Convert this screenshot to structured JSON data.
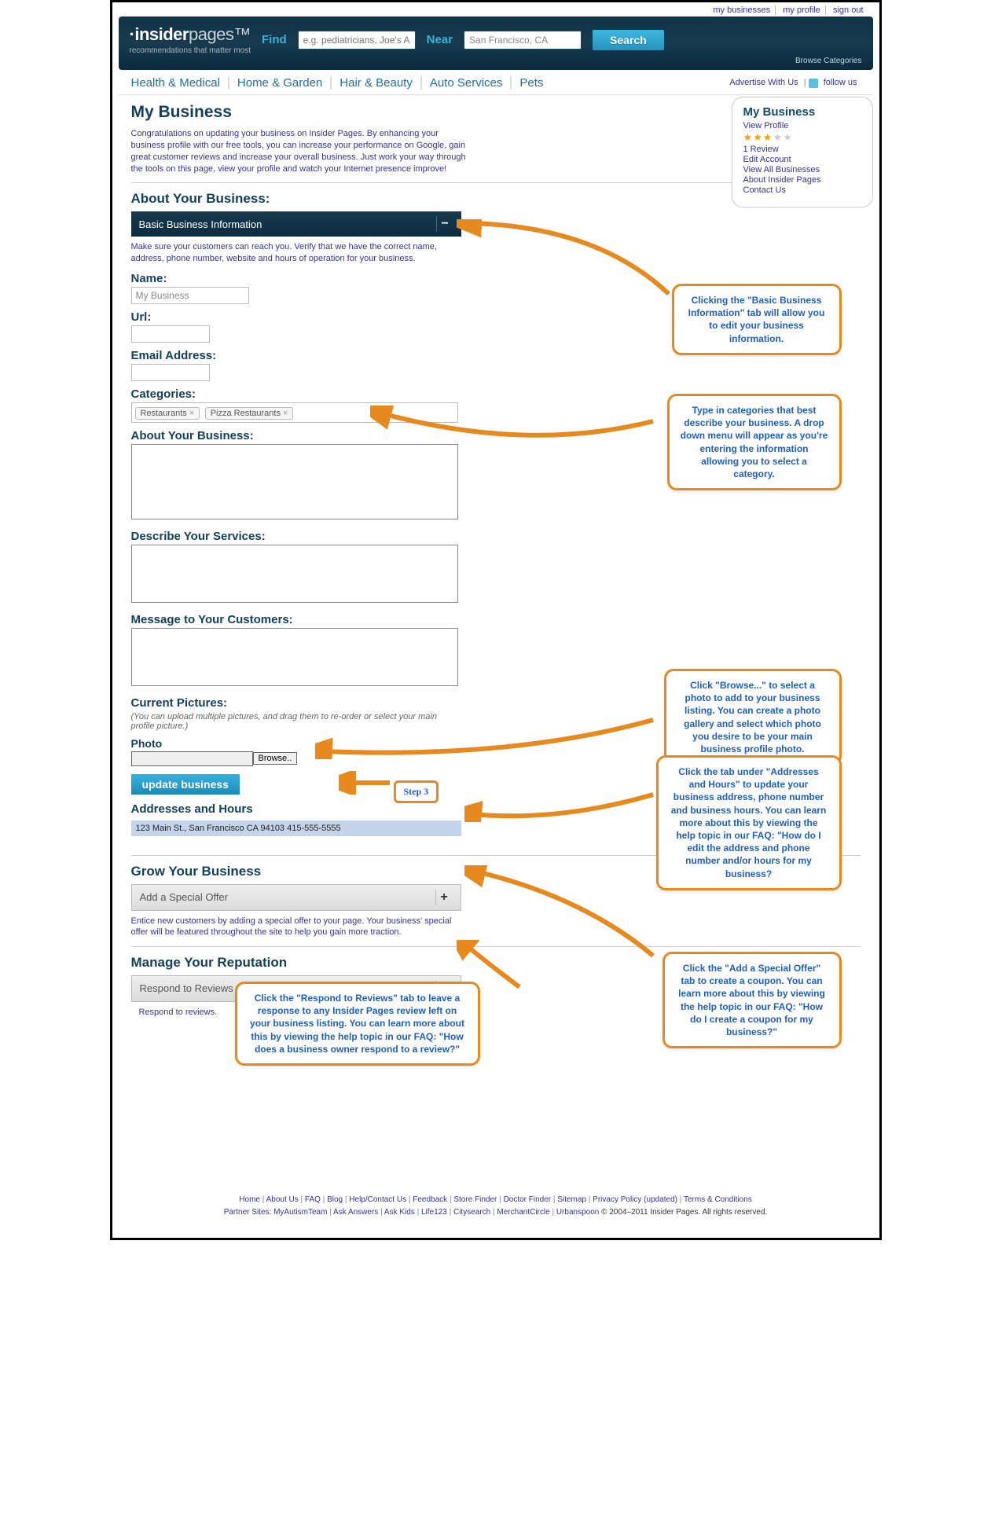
{
  "top_links": {
    "my_businesses": "my businesses",
    "my_profile": "my profile",
    "sign_out": "sign out"
  },
  "logo": {
    "bold": "insider",
    "norm": "pages",
    "tm": "™",
    "sub": "recommendations that matter most"
  },
  "search": {
    "find_label": "Find",
    "find_ph": "e.g. pediatricians, Joe's Auto",
    "near_label": "Near",
    "near_value": "San Francisco, CA",
    "button": "Search",
    "browse": "Browse Categories"
  },
  "nav": {
    "health": "Health & Medical",
    "home": "Home & Garden",
    "hair": "Hair & Beauty",
    "auto": "Auto Services",
    "pets": "Pets",
    "advertise": "Advertise With Us",
    "follow": "follow us"
  },
  "sidebox": {
    "title": "My Business",
    "view_profile": "View Profile",
    "one_review": "1 Review",
    "edit_account": "Edit Account",
    "view_all": "View All Businesses",
    "about_ip": "About Insider Pages",
    "contact": "Contact Us"
  },
  "page": {
    "title": "My Business",
    "intro": "Congratulations on updating your business on Insider Pages. By enhancing your business profile with our free tools, you can increase your performance on Google, gain great customer reviews and increase your overall business. Just work your way through the tools on this page, view your profile and watch your Internet presence improve!",
    "about_head": "About Your Business:",
    "accordion_basic": "Basic Business Information",
    "basic_help": "Make sure your customers can reach you. Verify that we have the correct name, address, phone number, website and hours of operation for your business.",
    "name_label": "Name:",
    "name_value": "My Business",
    "url_label": "Url:",
    "email_label": "Email Address:",
    "categories_label": "Categories:",
    "cat_tags": [
      "Restaurants",
      "Pizza Restaurants"
    ],
    "about_biz_label": "About Your Business:",
    "describe_label": "Describe Your Services:",
    "message_label": "Message to Your Customers:",
    "pictures_label": "Current Pictures:",
    "pictures_hint": "(You can upload multiple pictures, and drag them to re-order or select your main profile picture.)",
    "photo_label": "Photo",
    "browse_btn": "Browse..",
    "update_btn": "update business",
    "addr_head": "Addresses and Hours",
    "addr_row": "123 Main St., San Francisco CA 94103 415-555-5555",
    "grow_head": "Grow Your Business",
    "addoffer": "Add a Special Offer",
    "addoffer_help": "Entice new customers by adding a special offer to your page. Your business' special offer will be featured throughout the site to help you gain more traction.",
    "manage_head": "Manage Your Reputation",
    "respond": "Respond to Reviews",
    "respond_help": "Respond to reviews."
  },
  "callouts": {
    "c1": "Clicking the \"Basic Business Information\" tab will allow you to edit your business information.",
    "c2": "Type in categories that best describe your business. A drop down menu will appear as you're entering the information allowing you to select a category.",
    "c3": "Click \"Browse...\" to select a photo to add to your business listing. You can create a photo gallery and select which photo you desire to be your main business profile photo.",
    "c4": "Click the tab under \"Addresses and Hours\" to update your business address, phone number and business hours. You can learn more about this by viewing the help topic in our FAQ: \"How do I edit the address and phone number and/or hours for my business?",
    "c5": "Click the \"Add a Special Offer\" tab to create a coupon. You can learn more about this by viewing the help topic in our FAQ: \"How do I create a coupon for my business?\"",
    "c6": "Click the \"Respond to Reviews\" tab to leave a response to any Insider Pages review left on your business listing. You can learn more about this by viewing the help topic in our FAQ: \"How does a business owner respond to a review?\"",
    "step": "Step 3"
  },
  "footer": {
    "row1": [
      "Home",
      "About Us",
      "FAQ",
      "Blog",
      "Help/Contact Us",
      "Feedback",
      "Store Finder",
      "Doctor Finder",
      "Sitemap",
      "Privacy Policy (updated)",
      "Terms & Conditions"
    ],
    "row2_label": "Partner Sites:",
    "row2": [
      "MyAutismTeam",
      "Ask Answers",
      "Ask Kids",
      "Life123",
      "Citysearch",
      "MerchantCircle",
      "Urbanspoon"
    ],
    "copyright": "© 2004–2011 Insider Pages. All rights reserved."
  }
}
